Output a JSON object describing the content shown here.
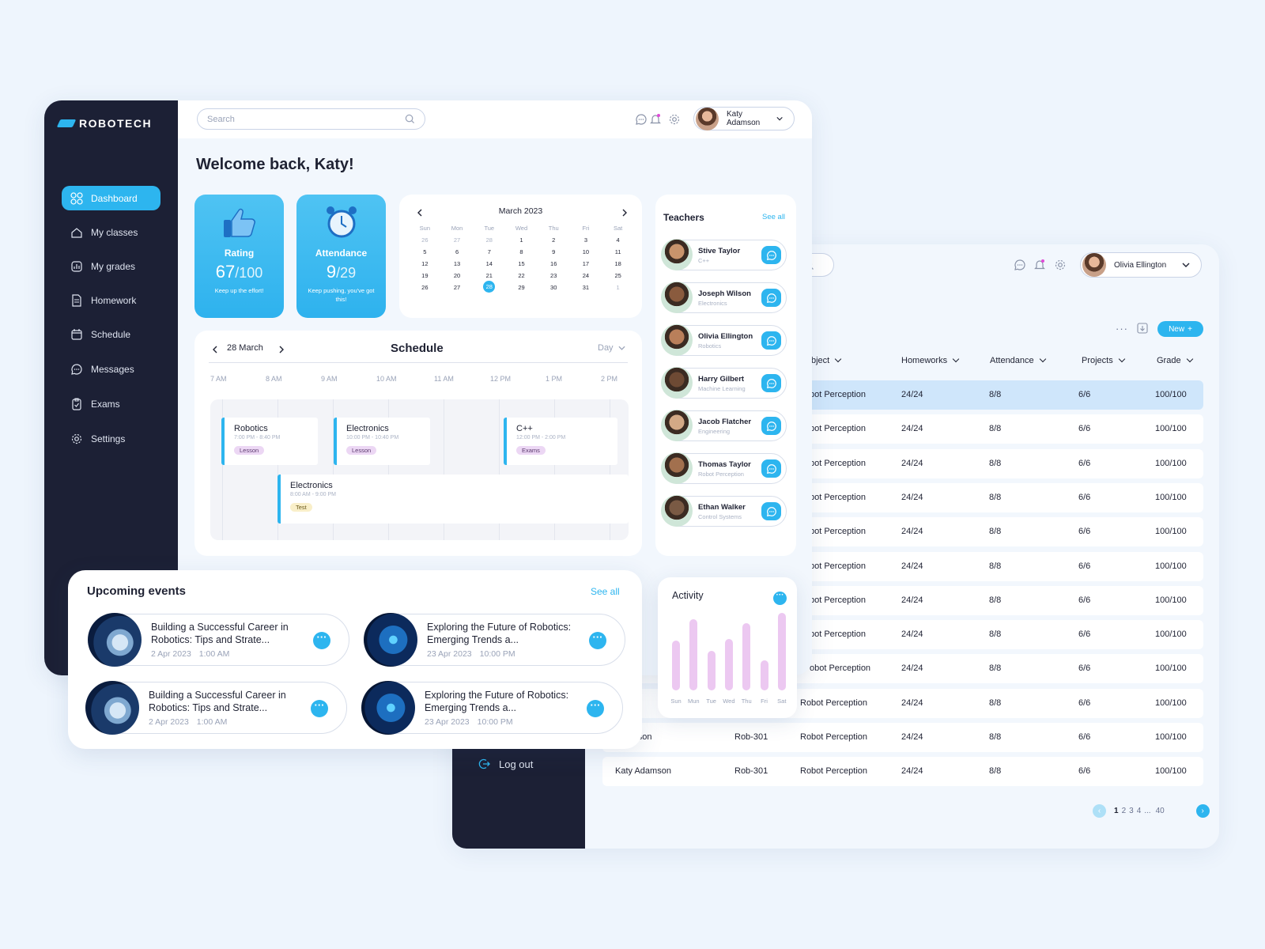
{
  "front": {
    "brand": "ROBOTECH",
    "search_placeholder": "Search",
    "user_name": "Katy Adamson",
    "welcome": "Welcome back, Katy!",
    "nav": [
      {
        "label": "Dashboard",
        "icon": "dashboard-icon",
        "active": true
      },
      {
        "label": "My classes",
        "icon": "home-icon"
      },
      {
        "label": "My grades",
        "icon": "grades-icon"
      },
      {
        "label": "Homework",
        "icon": "document-icon"
      },
      {
        "label": "Schedule",
        "icon": "calendar-icon"
      },
      {
        "label": "Messages",
        "icon": "chat-icon"
      },
      {
        "label": "Exams",
        "icon": "clipboard-icon"
      },
      {
        "label": "Settings",
        "icon": "gear-icon"
      }
    ],
    "rating": {
      "title": "Rating",
      "value": "67",
      "max": "/100",
      "subtitle": "Keep up the effort!"
    },
    "attendance": {
      "title": "Attendance",
      "value": "9",
      "max": "/29",
      "subtitle": "Keep pushing, you've got this!"
    },
    "calendar": {
      "title": "March 2023",
      "days": [
        "Sun",
        "Mon",
        "Tue",
        "Wed",
        "Thu",
        "Fri",
        "Sat"
      ],
      "weeks": [
        [
          "26",
          "27",
          "28",
          "1",
          "2",
          "3",
          "4"
        ],
        [
          "5",
          "6",
          "7",
          "8",
          "9",
          "10",
          "11"
        ],
        [
          "12",
          "13",
          "14",
          "15",
          "16",
          "17",
          "18"
        ],
        [
          "19",
          "20",
          "21",
          "22",
          "23",
          "24",
          "25"
        ],
        [
          "26",
          "27",
          "28",
          "29",
          "30",
          "31",
          "1"
        ]
      ],
      "today": "28"
    },
    "schedule": {
      "date": "28 March",
      "title": "Schedule",
      "view": "Day",
      "hours": [
        "7 AM",
        "8 AM",
        "9 AM",
        "10 AM",
        "11 AM",
        "12 PM",
        "1 PM",
        "2 PM"
      ],
      "events": [
        {
          "name": "Robotics",
          "time": "7:00 PM - 8:40 PM",
          "tag": "Lesson"
        },
        {
          "name": "Electronics",
          "time": "10:00 PM - 10:40 PM",
          "tag": "Lesson"
        },
        {
          "name": "C++",
          "time": "12:00 PM - 2:00 PM",
          "tag": "Exams"
        },
        {
          "name": "Electronics",
          "time": "8:00 AM - 9:00 PM",
          "tag": "Test"
        }
      ]
    },
    "teachers": {
      "title": "Teachers",
      "see_all": "See all",
      "list": [
        {
          "name": "Stive Taylor",
          "subject": "C++"
        },
        {
          "name": "Joseph Wilson",
          "subject": "Electronics"
        },
        {
          "name": "Olivia Ellington",
          "subject": "Robotics"
        },
        {
          "name": "Harry Gilbert",
          "subject": "Machine Learning"
        },
        {
          "name": "Jacob Flatcher",
          "subject": "Engineering"
        },
        {
          "name": "Thomas Taylor",
          "subject": "Robot Perception"
        },
        {
          "name": "Ethan Walker",
          "subject": "Control Systems"
        }
      ]
    },
    "upcoming": {
      "title": "Upcoming events",
      "see_all": "See all",
      "events": [
        {
          "title": "Building a Successful Career in Robotics: Tips and Strate...",
          "date": "2 Apr 2023",
          "time": "1:00 AM"
        },
        {
          "title": "Exploring the Future of Robotics: Emerging Trends a...",
          "date": "23 Apr 2023",
          "time": "10:00 PM"
        },
        {
          "title": "Building a Successful Career in Robotics: Tips and Strate...",
          "date": "2 Apr 2023",
          "time": "1:00 AM"
        },
        {
          "title": "Exploring the Future of Robotics: Emerging Trends a...",
          "date": "23 Apr 2023",
          "time": "10:00 PM"
        }
      ]
    },
    "activity": {
      "title": "Activity",
      "days": [
        "Sun",
        "Mun",
        "Tue",
        "Wed",
        "Thu",
        "Fri",
        "Sat"
      ],
      "levels": [
        0.62,
        0.88,
        0.49,
        0.64,
        0.83,
        0.37,
        0.96
      ],
      "color": "#ecc8f1"
    }
  },
  "back": {
    "user_name": "Olivia Ellington",
    "new_label": "New",
    "logout": "Log out",
    "columns": [
      "bject",
      "Homeworks",
      "Attendance",
      "Projects",
      "Grade"
    ],
    "rows": [
      {
        "name": "",
        "code": "",
        "subject": "bot Perception",
        "homeworks": "24/24",
        "attendance": "8/8",
        "projects": "6/6",
        "grade": "100/100"
      },
      {
        "name": "",
        "code": "",
        "subject": "bot Perception",
        "homeworks": "24/24",
        "attendance": "8/8",
        "projects": "6/6",
        "grade": "100/100"
      },
      {
        "name": "",
        "code": "",
        "subject": "bot Perception",
        "homeworks": "24/24",
        "attendance": "8/8",
        "projects": "6/6",
        "grade": "100/100"
      },
      {
        "name": "",
        "code": "",
        "subject": "bot Perception",
        "homeworks": "24/24",
        "attendance": "8/8",
        "projects": "6/6",
        "grade": "100/100"
      },
      {
        "name": "",
        "code": "",
        "subject": "bot Perception",
        "homeworks": "24/24",
        "attendance": "8/8",
        "projects": "6/6",
        "grade": "100/100"
      },
      {
        "name": "",
        "code": "",
        "subject": "bot Perception",
        "homeworks": "24/24",
        "attendance": "8/8",
        "projects": "6/6",
        "grade": "100/100"
      },
      {
        "name": "",
        "code": "",
        "subject": "bot Perception",
        "homeworks": "24/24",
        "attendance": "8/8",
        "projects": "6/6",
        "grade": "100/100"
      },
      {
        "name": "",
        "code": "",
        "subject": "bot Perception",
        "homeworks": "24/24",
        "attendance": "8/8",
        "projects": "6/6",
        "grade": "100/100"
      },
      {
        "name": "",
        "code": "",
        "subject": "obot Perception",
        "homeworks": "24/24",
        "attendance": "8/8",
        "projects": "6/6",
        "grade": "100/100"
      },
      {
        "name": "dar",
        "code": "",
        "subject": "Robot Perception",
        "homeworks": "24/24",
        "attendance": "8/8",
        "projects": "6/6",
        "grade": "100/100"
      },
      {
        "name": "Adamson",
        "code": "Rob-301",
        "subject": "Robot Perception",
        "homeworks": "24/24",
        "attendance": "8/8",
        "projects": "6/6",
        "grade": "100/100"
      },
      {
        "name": "Katy Adamson",
        "code": "Rob-301",
        "subject": "Robot Perception",
        "homeworks": "24/24",
        "attendance": "8/8",
        "projects": "6/6",
        "grade": "100/100"
      }
    ],
    "pages": [
      "1",
      "2",
      "3",
      "4",
      "...",
      "40"
    ],
    "current_page": "1"
  },
  "colors": {
    "accent": "#2db5ef",
    "sidebar": "#1c2035",
    "background": "#eef5fd"
  }
}
